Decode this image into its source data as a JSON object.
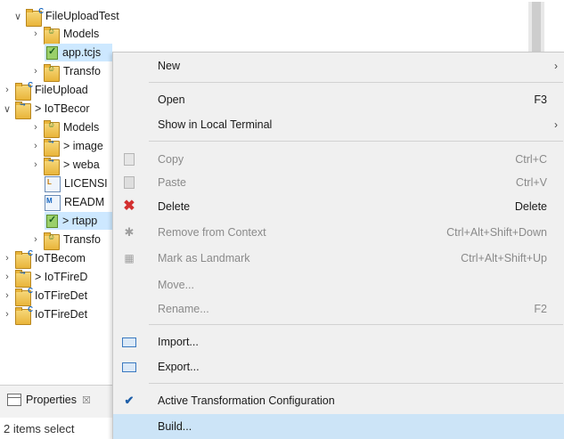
{
  "tree": {
    "items": [
      {
        "label": "FileUploadTest",
        "icon": "project-folder-icon",
        "twisty": "expanded"
      },
      {
        "label": "Models",
        "icon": "models-folder-icon",
        "twisty": "collapsed"
      },
      {
        "label": "app.tcjs",
        "icon": "tcjs-file-icon",
        "twisty": "none",
        "selected": true
      },
      {
        "label": "Transfo",
        "icon": "transformations-folder-icon",
        "twisty": "collapsed"
      },
      {
        "label": "FileUpload",
        "icon": "project-folder-icon",
        "twisty": "collapsed"
      },
      {
        "label": "> IoTBecor",
        "icon": "external-project-icon",
        "twisty": "expanded"
      },
      {
        "label": "Models",
        "icon": "models-folder-icon",
        "twisty": "collapsed"
      },
      {
        "label": "> image",
        "icon": "external-folder-icon",
        "twisty": "collapsed"
      },
      {
        "label": "> weba",
        "icon": "external-folder-icon",
        "twisty": "collapsed"
      },
      {
        "label": "LICENSI",
        "icon": "license-file-icon",
        "twisty": "none"
      },
      {
        "label": "READM",
        "icon": "readme-file-icon",
        "twisty": "none"
      },
      {
        "label": "> rtapp",
        "icon": "tcjs-file-icon",
        "twisty": "none",
        "selected": true
      },
      {
        "label": "Transfo",
        "icon": "transformations-folder-icon",
        "twisty": "collapsed"
      },
      {
        "label": "IoTBecom",
        "icon": "project-folder-icon",
        "twisty": "collapsed"
      },
      {
        "label": "> IoTFireD",
        "icon": "external-project-icon",
        "twisty": "collapsed"
      },
      {
        "label": "IoTFireDet",
        "icon": "project-folder-icon",
        "twisty": "collapsed"
      },
      {
        "label": "IoTFireDet",
        "icon": "project-folder-icon",
        "twisty": "collapsed"
      }
    ]
  },
  "properties": {
    "tab_label": "Properties",
    "close_glyph": "☒"
  },
  "status_text": "2 items select",
  "menu": {
    "items": [
      {
        "label": "New",
        "shortcut": "",
        "submenu": true,
        "enabled": true
      },
      {
        "label": "Open",
        "shortcut": "F3",
        "enabled": true
      },
      {
        "label": "Show in Local Terminal",
        "shortcut": "",
        "submenu": true,
        "enabled": true
      },
      {
        "label": "Copy",
        "shortcut": "Ctrl+C",
        "enabled": false
      },
      {
        "label": "Paste",
        "shortcut": "Ctrl+V",
        "enabled": false
      },
      {
        "label": "Delete",
        "shortcut": "Delete",
        "enabled": true
      },
      {
        "label": "Remove from Context",
        "shortcut": "Ctrl+Alt+Shift+Down",
        "enabled": false
      },
      {
        "label": "Mark as Landmark",
        "shortcut": "Ctrl+Alt+Shift+Up",
        "enabled": false
      },
      {
        "label": "Move...",
        "shortcut": "",
        "enabled": false
      },
      {
        "label": "Rename...",
        "shortcut": "F2",
        "enabled": false
      },
      {
        "label": "Import...",
        "shortcut": "",
        "enabled": true
      },
      {
        "label": "Export...",
        "shortcut": "",
        "enabled": true
      },
      {
        "label": "Active Transformation Configuration",
        "shortcut": "",
        "enabled": true,
        "checked": true
      },
      {
        "label": "Build...",
        "shortcut": "",
        "enabled": true,
        "highlighted": true
      }
    ],
    "submenu_glyph": "›"
  },
  "colors": {
    "selection": "#cde8ff",
    "menu_bg": "#f0f0f0",
    "menu_highlight": "#cce4f7",
    "disabled_text": "#8a8a8a"
  }
}
